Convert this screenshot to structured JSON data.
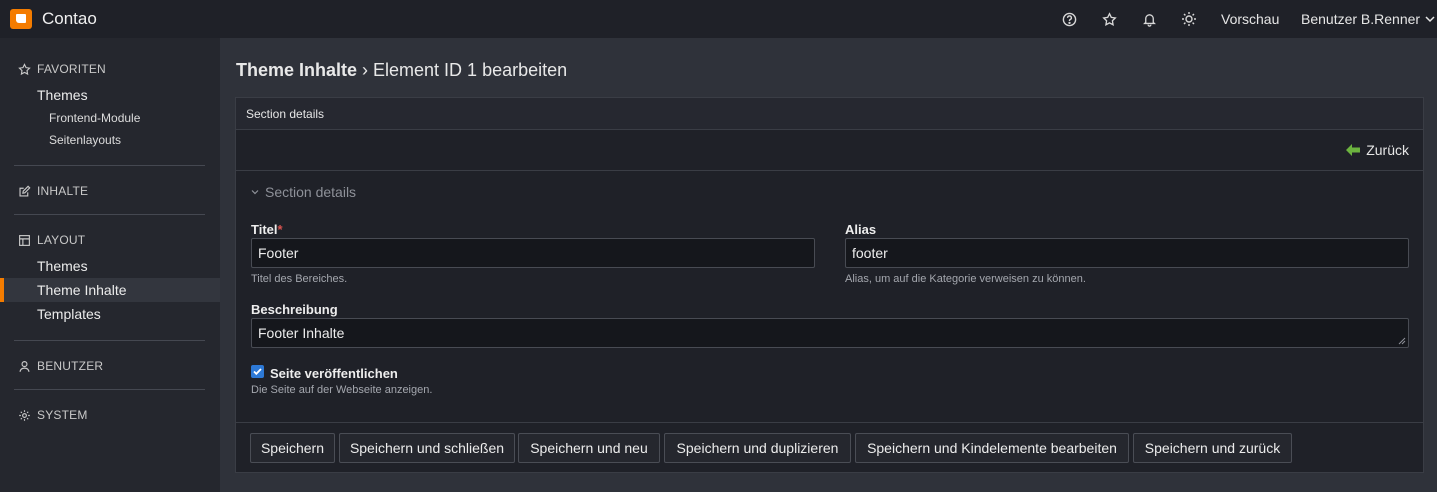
{
  "app": {
    "title": "Contao"
  },
  "header": {
    "help_icon": "help-circle-icon",
    "favorites_icon": "star-icon",
    "notifications_icon": "bell-icon",
    "theme_icon": "sun-icon",
    "preview_label": "Vorschau",
    "user_label": "Benutzer B.Renner"
  },
  "sidebar": {
    "favorites": {
      "label": "FAVORITEN",
      "items": [
        "Themes"
      ],
      "sub_items": [
        "Frontend-Module",
        "Seitenlayouts"
      ]
    },
    "content": {
      "label": "INHALTE"
    },
    "layout": {
      "label": "LAYOUT",
      "items": [
        "Themes",
        "Theme Inhalte",
        "Templates"
      ],
      "active": "Theme Inhalte"
    },
    "users": {
      "label": "BENUTZER"
    },
    "system": {
      "label": "SYSTEM"
    }
  },
  "page": {
    "title_strong": "Theme Inhalte",
    "title_rest": " › Element ID 1 bearbeiten"
  },
  "panel": {
    "header": "Section details",
    "back_label": "Zurück",
    "legend": "Section details"
  },
  "form": {
    "title": {
      "label": "Titel",
      "required_mark": "*",
      "value": "Footer",
      "help": "Titel des Bereiches."
    },
    "alias": {
      "label": "Alias",
      "value": "footer",
      "help": "Alias, um auf die Kategorie verweisen zu können."
    },
    "description": {
      "label": "Beschreibung",
      "value": "Footer Inhalte"
    },
    "publish": {
      "label": "Seite veröffentlichen",
      "checked": true,
      "help": "Die Seite auf der Webseite anzeigen."
    }
  },
  "buttons": [
    "Speichern",
    "Speichern und schließen",
    "Speichern und neu",
    "Speichern und duplizieren",
    "Speichern und Kindelemente bearbeiten",
    "Speichern und zurück"
  ],
  "colors": {
    "accent": "#f47c00",
    "back_arrow": "#6cb33f",
    "checkbox": "#2d79d6",
    "required": "#d9534f"
  }
}
